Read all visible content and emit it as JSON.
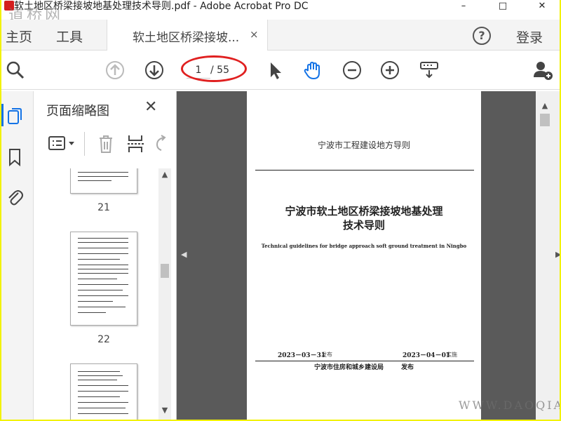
{
  "window": {
    "title": "软土地区桥梁接坡地基处理技术导则.pdf - Adobe Acrobat Pro DC",
    "watermark_top": "道桥网",
    "minimize": "–",
    "maximize": "□",
    "close": "✕"
  },
  "menubar": {
    "home": "主页",
    "tools": "工具",
    "tab_label": "软土地区桥梁接坡...",
    "tab_close": "×",
    "help": "?",
    "login": "登录"
  },
  "toolbar": {
    "current_page": "1",
    "total_pages": "/ 55"
  },
  "thumbnail_panel": {
    "title": "页面缩略图",
    "close": "✕",
    "pages": [
      {
        "number": "21"
      },
      {
        "number": "22"
      }
    ]
  },
  "document": {
    "header": "宁波市工程建设地方导则",
    "title_line1": "宁波市软土地区桥梁接坡地基处理",
    "title_line2": "技术导则",
    "subtitle_en": "Technical guidelines for bridge approach soft ground treatment in Ningbo",
    "publish_date": "2023－03－31",
    "publish_label": "发布",
    "effective_date": "2023－04－01",
    "effective_label": "实施",
    "issuer": "宁波市住房和城乡建设局",
    "issuer_action": "发布"
  },
  "watermark_bottom": "WWW.DAOQIAO.COM",
  "colors": {
    "frame_border": "#f2f200",
    "annotation_red": "#e02020",
    "accent_blue": "#1473e6",
    "doc_background": "#5a5a5a"
  }
}
